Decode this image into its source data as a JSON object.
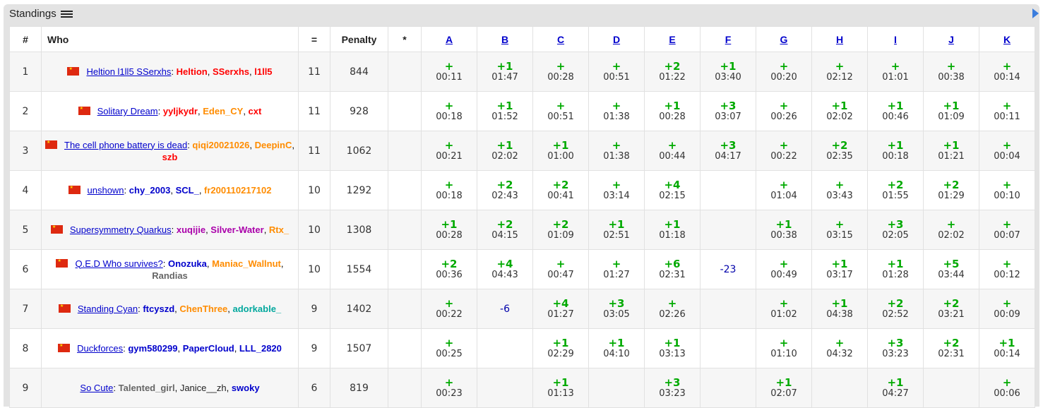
{
  "header": {
    "title": "Standings"
  },
  "columns": [
    "#",
    "Who",
    "=",
    "Penalty",
    "*",
    "A",
    "B",
    "C",
    "D",
    "E",
    "F",
    "G",
    "H",
    "I",
    "J",
    "K"
  ],
  "rows": [
    {
      "rank": "1",
      "team": "Heltion l1ll5 SSerxhs",
      "members": [
        {
          "name": "Heltion",
          "color": "red"
        },
        {
          "name": "SSerxhs",
          "color": "red"
        },
        {
          "name": "l1ll5",
          "color": "red"
        }
      ],
      "solved": "11",
      "penalty": "844",
      "cells": [
        [
          "+",
          "00:11"
        ],
        [
          "+1",
          "01:47"
        ],
        [
          "+",
          "00:28"
        ],
        [
          "+",
          "00:51"
        ],
        [
          "+2",
          "01:22"
        ],
        [
          "+1",
          "03:40"
        ],
        [
          "+",
          "00:20"
        ],
        [
          "+",
          "02:12"
        ],
        [
          "+",
          "01:01"
        ],
        [
          "+",
          "00:38"
        ],
        [
          "+",
          "00:14"
        ]
      ]
    },
    {
      "rank": "2",
      "team": "Solitary Dream",
      "members": [
        {
          "name": "yyljkydr",
          "color": "red"
        },
        {
          "name": "Eden_CY",
          "color": "orange"
        },
        {
          "name": "cxt",
          "color": "red"
        }
      ],
      "solved": "11",
      "penalty": "928",
      "cells": [
        [
          "+",
          "00:18"
        ],
        [
          "+1",
          "01:52"
        ],
        [
          "+",
          "00:51"
        ],
        [
          "+",
          "01:38"
        ],
        [
          "+1",
          "00:28"
        ],
        [
          "+3",
          "03:07"
        ],
        [
          "+",
          "00:26"
        ],
        [
          "+1",
          "02:02"
        ],
        [
          "+1",
          "00:46"
        ],
        [
          "+1",
          "01:09"
        ],
        [
          "+",
          "00:11"
        ]
      ]
    },
    {
      "rank": "3",
      "team": "The cell phone battery is dead",
      "members": [
        {
          "name": "qiqi20021026",
          "color": "orange"
        },
        {
          "name": "DeepinC",
          "color": "orange"
        },
        {
          "name": "szb",
          "color": "red"
        }
      ],
      "solved": "11",
      "penalty": "1062",
      "cells": [
        [
          "+",
          "00:21"
        ],
        [
          "+1",
          "02:02"
        ],
        [
          "+1",
          "01:00"
        ],
        [
          "+",
          "01:38"
        ],
        [
          "+",
          "00:44"
        ],
        [
          "+3",
          "04:17"
        ],
        [
          "+",
          "00:22"
        ],
        [
          "+2",
          "02:35"
        ],
        [
          "+1",
          "00:18"
        ],
        [
          "+1",
          "01:21"
        ],
        [
          "+",
          "00:04"
        ]
      ]
    },
    {
      "rank": "4",
      "team": "unshown",
      "members": [
        {
          "name": "chy_2003",
          "color": "blue"
        },
        {
          "name": "SCL_",
          "color": "blue"
        },
        {
          "name": "fr200110217102",
          "color": "orange"
        }
      ],
      "solved": "10",
      "penalty": "1292",
      "cells": [
        [
          "+",
          "00:18"
        ],
        [
          "+2",
          "02:43"
        ],
        [
          "+2",
          "00:41"
        ],
        [
          "+",
          "03:14"
        ],
        [
          "+4",
          "02:15"
        ],
        null,
        [
          "+",
          "01:04"
        ],
        [
          "+",
          "03:43"
        ],
        [
          "+2",
          "01:55"
        ],
        [
          "+2",
          "01:29"
        ],
        [
          "+",
          "00:10"
        ]
      ]
    },
    {
      "rank": "5",
      "team": "Supersymmetry Quarkus",
      "members": [
        {
          "name": "xuqijie",
          "color": "purple"
        },
        {
          "name": "Silver-Water",
          "color": "purple"
        },
        {
          "name": "Rtx_",
          "color": "orange"
        }
      ],
      "solved": "10",
      "penalty": "1308",
      "cells": [
        [
          "+1",
          "00:28"
        ],
        [
          "+2",
          "04:15"
        ],
        [
          "+2",
          "01:09"
        ],
        [
          "+1",
          "02:51"
        ],
        [
          "+1",
          "01:18"
        ],
        null,
        [
          "+1",
          "00:38"
        ],
        [
          "+",
          "03:15"
        ],
        [
          "+3",
          "02:05"
        ],
        [
          "+",
          "02:02"
        ],
        [
          "+",
          "00:07"
        ]
      ]
    },
    {
      "rank": "6",
      "team": "Q.E.D Who survives?",
      "members": [
        {
          "name": "Onozuka",
          "color": "blue"
        },
        {
          "name": "Maniac_Wallnut",
          "color": "orange"
        },
        {
          "name": "Randias",
          "color": "gray"
        }
      ],
      "solved": "10",
      "penalty": "1554",
      "cells": [
        [
          "+2",
          "00:36"
        ],
        [
          "+4",
          "04:43"
        ],
        [
          "+",
          "00:47"
        ],
        [
          "+",
          "01:27"
        ],
        [
          "+6",
          "02:31"
        ],
        "-23",
        [
          "+",
          "00:49"
        ],
        [
          "+1",
          "03:17"
        ],
        [
          "+1",
          "01:28"
        ],
        [
          "+5",
          "03:44"
        ],
        [
          "+",
          "00:12"
        ]
      ]
    },
    {
      "rank": "7",
      "team": "Standing Cyan",
      "members": [
        {
          "name": "ftcyszd",
          "color": "blue"
        },
        {
          "name": "ChenThree",
          "color": "orange"
        },
        {
          "name": "adorkable_",
          "color": "cyan"
        }
      ],
      "solved": "9",
      "penalty": "1402",
      "cells": [
        [
          "+",
          "00:22"
        ],
        "-6",
        [
          "+4",
          "01:27"
        ],
        [
          "+3",
          "03:05"
        ],
        [
          "+",
          "02:26"
        ],
        null,
        [
          "+",
          "01:02"
        ],
        [
          "+1",
          "04:38"
        ],
        [
          "+2",
          "02:52"
        ],
        [
          "+2",
          "03:21"
        ],
        [
          "+",
          "00:09"
        ]
      ]
    },
    {
      "rank": "8",
      "team": "Duckforces",
      "members": [
        {
          "name": "gym580299",
          "color": "blue"
        },
        {
          "name": "PaperCloud",
          "color": "blue"
        },
        {
          "name": "LLL_2820",
          "color": "blue"
        }
      ],
      "solved": "9",
      "penalty": "1507",
      "cells": [
        [
          "+",
          "00:25"
        ],
        null,
        [
          "+1",
          "02:29"
        ],
        [
          "+1",
          "04:10"
        ],
        [
          "+1",
          "03:13"
        ],
        null,
        [
          "+",
          "01:10"
        ],
        [
          "+",
          "04:32"
        ],
        [
          "+3",
          "03:23"
        ],
        [
          "+2",
          "02:31"
        ],
        [
          "+1",
          "00:14"
        ]
      ]
    },
    {
      "rank": "9",
      "team": "So Cute",
      "members": [
        {
          "name": "Talented_girl",
          "color": "gray"
        },
        {
          "name": "Janice__zh",
          "color": "black"
        },
        {
          "name": "swoky",
          "color": "blue"
        }
      ],
      "solved": "6",
      "penalty": "819",
      "cells": [
        [
          "+",
          "00:23"
        ],
        null,
        [
          "+1",
          "01:13"
        ],
        null,
        [
          "+3",
          "03:23"
        ],
        null,
        [
          "+1",
          "02:07"
        ],
        null,
        [
          "+1",
          "04:27"
        ],
        null,
        [
          "+",
          "00:06"
        ]
      ]
    }
  ]
}
